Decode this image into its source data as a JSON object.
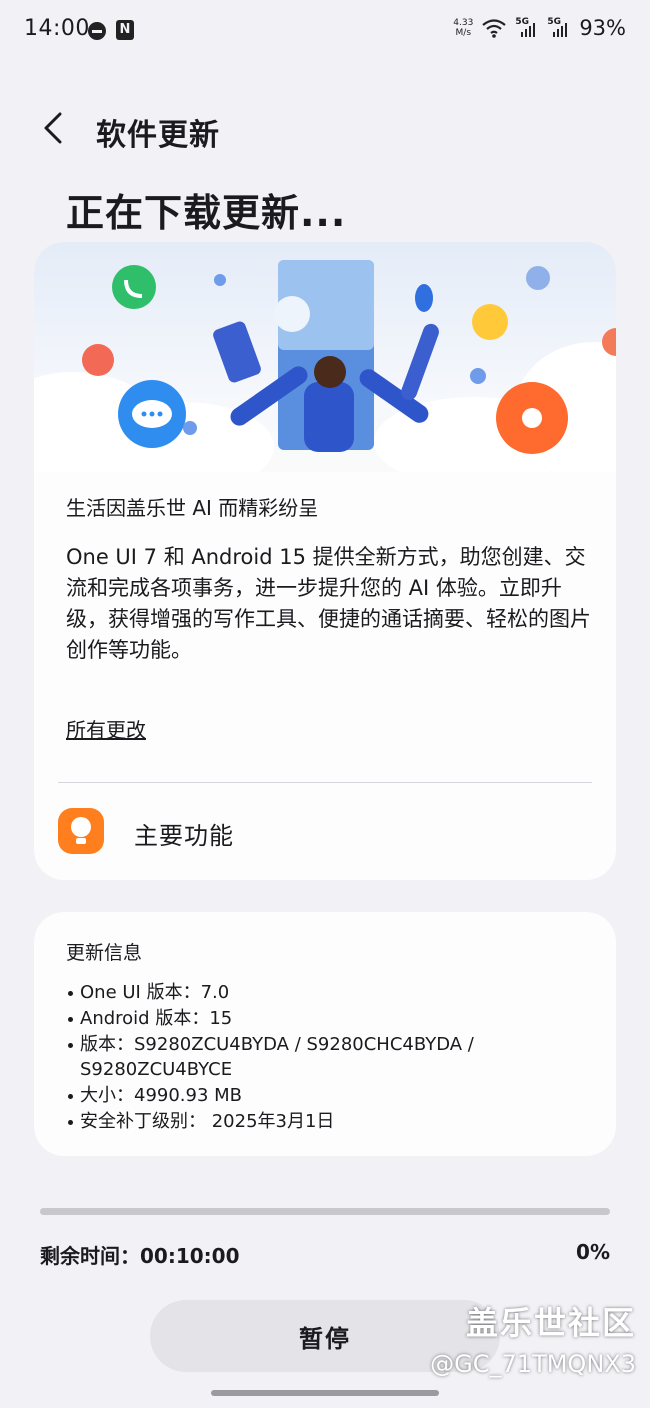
{
  "status_bar": {
    "time": "14:00",
    "net_speed_value": "4.33",
    "net_speed_unit": "M/s",
    "signal1_label": "5G",
    "signal2_label": "5G",
    "battery": "93%",
    "icons": [
      "do-not-disturb-icon",
      "nfc-icon",
      "wifi-icon",
      "signal-icon",
      "signal-icon"
    ]
  },
  "header": {
    "title": "软件更新"
  },
  "page": {
    "status_title": "正在下载更新..."
  },
  "update_card": {
    "headline": "生活因盖乐世 AI 而精彩纷呈",
    "body": "One UI 7 和 Android 15 提供全新方式，助您创建、交流和完成各项事务，进一步提升您的 AI 体验。立即升级，获得增强的写作工具、便捷的通话摘要、轻松的图片创作等功能。",
    "all_changes_link": "所有更改",
    "feature_label": "主要功能"
  },
  "info_card": {
    "title": "更新信息",
    "items": [
      "One UI 版本：7.0",
      "Android 版本：15",
      "版本：S9280ZCU4BYDA / S9280CHC4BYDA / S9280ZCU4BYCE",
      "大小：4990.93 MB",
      "安全补丁级别： 2025年3月1日"
    ]
  },
  "download": {
    "remaining_label": "剩余时间：",
    "remaining_time": "00:10:00",
    "percent_text": "0%",
    "progress_fraction": 0
  },
  "actions": {
    "pause_label": "暂停"
  },
  "watermark": {
    "brand": "盖乐世社区",
    "user": "@GC_71TMQNX3"
  },
  "colors": {
    "background": "#f1f1f6",
    "card": "#fdfdfd",
    "accent_orange": "#ff7f1e",
    "progress_track": "#c7c7cc",
    "button_bg": "#e3e3e8"
  }
}
